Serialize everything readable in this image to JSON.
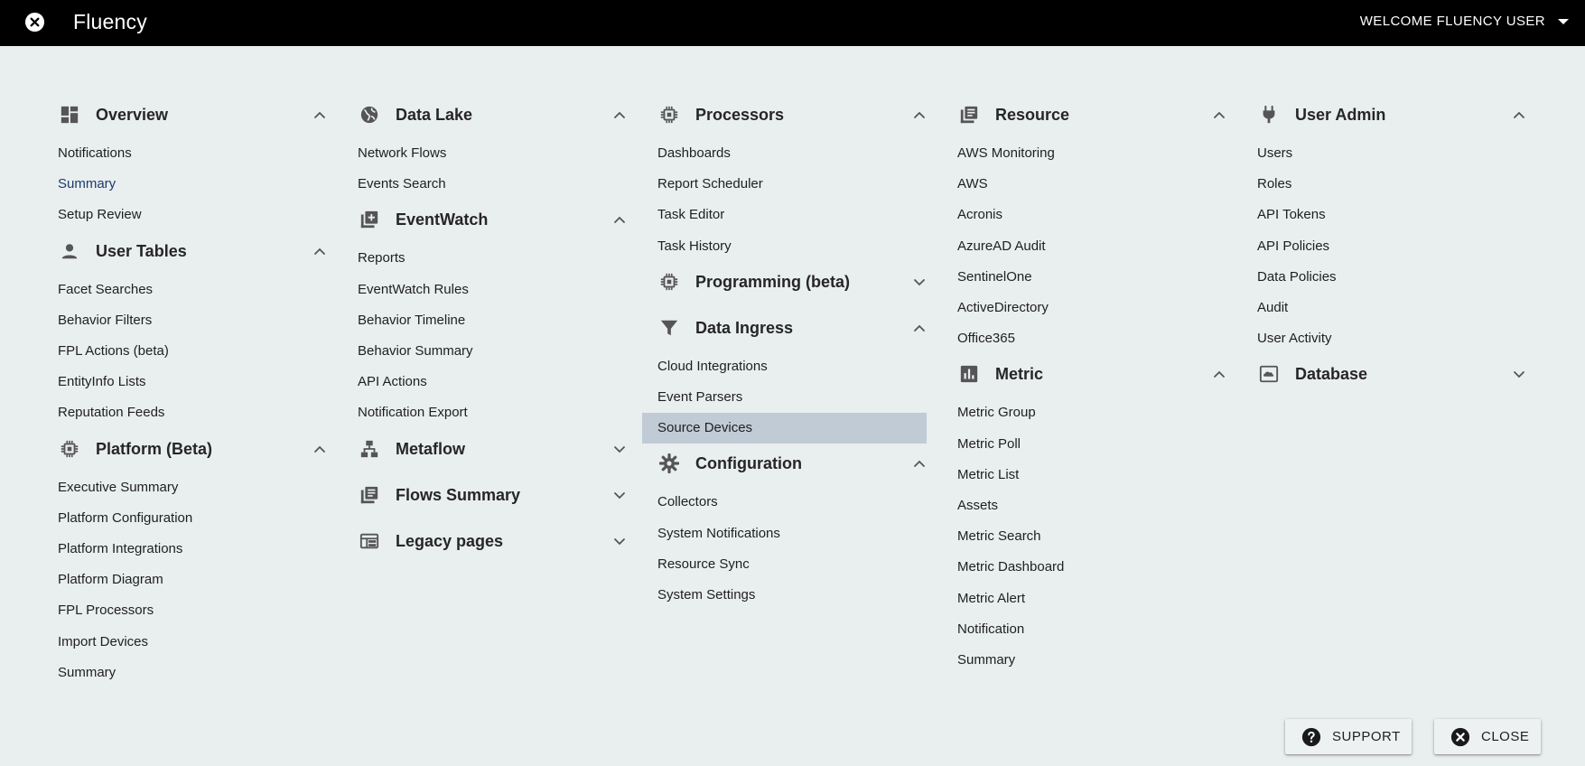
{
  "header": {
    "app_title": "Fluency",
    "welcome": "WELCOME FLUENCY USER"
  },
  "colors": {
    "topbar": "#000000",
    "background": "#e9eeef",
    "selected": "#c0cbd6",
    "link": "#1b3b6b"
  },
  "columns": [
    [
      {
        "title": "Overview",
        "icon": "dashboard-icon",
        "expanded": true,
        "items": [
          "Notifications",
          "Summary",
          "Setup Review"
        ]
      },
      {
        "title": "User Tables",
        "icon": "person-icon",
        "expanded": true,
        "items": [
          "Facet Searches",
          "Behavior Filters",
          "FPL Actions (beta)",
          "EntityInfo Lists",
          "Reputation Feeds"
        ]
      },
      {
        "title": "Platform (Beta)",
        "icon": "chip-icon",
        "expanded": true,
        "items": [
          "Executive Summary",
          "Platform Configuration",
          "Platform Integrations",
          "Platform Diagram",
          "FPL Processors",
          "Import Devices",
          "Summary"
        ]
      }
    ],
    [
      {
        "title": "Data Lake",
        "icon": "globe-icon",
        "expanded": true,
        "items": [
          "Network Flows",
          "Events Search"
        ]
      },
      {
        "title": "EventWatch",
        "icon": "library-add-icon",
        "expanded": true,
        "items": [
          "Reports",
          "EventWatch Rules",
          "Behavior Timeline",
          "Behavior Summary",
          "API Actions",
          "Notification Export"
        ]
      },
      {
        "title": "Metaflow",
        "icon": "hierarchy-icon",
        "expanded": false,
        "items": []
      },
      {
        "title": "Flows Summary",
        "icon": "library-books-icon",
        "expanded": false,
        "items": []
      },
      {
        "title": "Legacy pages",
        "icon": "web-icon",
        "expanded": false,
        "items": []
      }
    ],
    [
      {
        "title": "Processors",
        "icon": "chip-icon",
        "expanded": true,
        "items": [
          "Dashboards",
          "Report Scheduler",
          "Task Editor",
          "Task History"
        ]
      },
      {
        "title": "Programming (beta)",
        "icon": "chip-icon",
        "expanded": false,
        "items": []
      },
      {
        "title": "Data Ingress",
        "icon": "filter-icon",
        "expanded": true,
        "items": [
          "Cloud Integrations",
          "Event Parsers",
          "Source Devices"
        ]
      },
      {
        "title": "Configuration",
        "icon": "gear-icon",
        "expanded": true,
        "items": [
          "Collectors",
          "System Notifications",
          "Resource Sync",
          "System Settings"
        ]
      }
    ],
    [
      {
        "title": "Resource",
        "icon": "library-books-icon",
        "expanded": true,
        "items": [
          "AWS Monitoring",
          "AWS",
          "Acronis",
          "AzureAD Audit",
          "SentinelOne",
          "ActiveDirectory",
          "Office365"
        ]
      },
      {
        "title": "Metric",
        "icon": "bar-chart-icon",
        "expanded": true,
        "items": [
          "Metric Group",
          "Metric Poll",
          "Metric List",
          "Assets",
          "Metric Search",
          "Metric Dashboard",
          "Metric Alert",
          "Notification",
          "Summary"
        ]
      }
    ],
    [
      {
        "title": "User Admin",
        "icon": "plug-icon",
        "expanded": true,
        "items": [
          "Users",
          "Roles",
          "API Tokens",
          "API Policies",
          "Data Policies",
          "Audit",
          "User Activity"
        ]
      },
      {
        "title": "Database",
        "icon": "cloud-storage-icon",
        "expanded": false,
        "items": []
      }
    ]
  ],
  "selected_item": "Source Devices",
  "active_link": "Summary",
  "buttons": {
    "support": "SUPPORT",
    "close": "CLOSE"
  }
}
